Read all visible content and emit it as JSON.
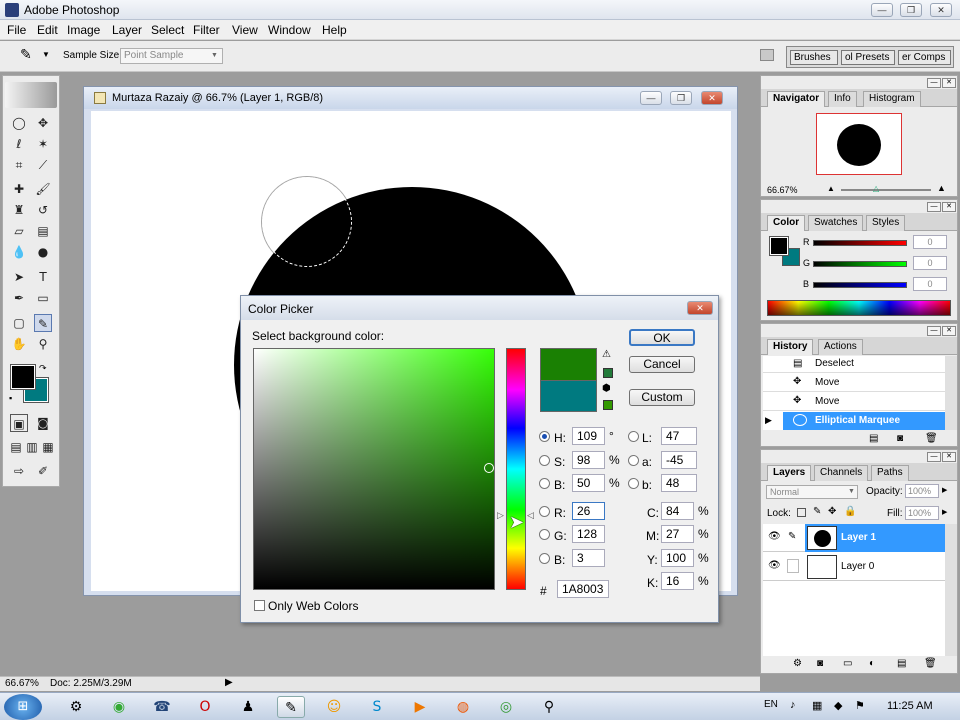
{
  "app": {
    "title": "Adobe Photoshop"
  },
  "menu": [
    "File",
    "Edit",
    "Image",
    "Layer",
    "Select",
    "Filter",
    "View",
    "Window",
    "Help"
  ],
  "options": {
    "sample_label": "Sample Size:",
    "sample_value": "Point Sample",
    "tabs": [
      "Brushes",
      "ol Presets",
      "er Comps"
    ]
  },
  "document": {
    "title": "Murtaza Razaiy @ 66.7% (Layer 1, RGB/8)"
  },
  "picker": {
    "title": "Color Picker",
    "prompt": "Select background color:",
    "ok": "OK",
    "cancel": "Cancel",
    "custom": "Custom",
    "new_color": "#1a8003",
    "current_color": "#007a80",
    "hsb": [
      {
        "label": "H:",
        "value": "109",
        "unit": "°"
      },
      {
        "label": "S:",
        "value": "98",
        "unit": "%"
      },
      {
        "label": "B:",
        "value": "50",
        "unit": "%"
      }
    ],
    "rgb": [
      {
        "label": "R:",
        "value": "26"
      },
      {
        "label": "G:",
        "value": "128"
      },
      {
        "label": "B:",
        "value": "3"
      }
    ],
    "lab": [
      {
        "label": "L:",
        "value": "47"
      },
      {
        "label": "a:",
        "value": "-45"
      },
      {
        "label": "b:",
        "value": "48"
      }
    ],
    "cmyk": [
      {
        "label": "C:",
        "value": "84",
        "unit": "%"
      },
      {
        "label": "M:",
        "value": "27",
        "unit": "%"
      },
      {
        "label": "Y:",
        "value": "100",
        "unit": "%"
      },
      {
        "label": "K:",
        "value": "16",
        "unit": "%"
      }
    ],
    "hex_label": "#",
    "hex": "1A8003",
    "web_only": "Only Web Colors"
  },
  "navigator": {
    "tabs": [
      "Navigator",
      "Info",
      "Histogram"
    ],
    "zoom": "66.67%"
  },
  "color_panel": {
    "tabs": [
      "Color",
      "Swatches",
      "Styles"
    ],
    "channels": [
      {
        "label": "R",
        "value": "0"
      },
      {
        "label": "G",
        "value": "0"
      },
      {
        "label": "B",
        "value": "0"
      }
    ]
  },
  "history": {
    "tabs": [
      "History",
      "Actions"
    ],
    "items": [
      "Deselect",
      "Move",
      "Move",
      "Elliptical Marquee"
    ]
  },
  "layers": {
    "tabs": [
      "Layers",
      "Channels",
      "Paths"
    ],
    "blend": "Normal",
    "opacity_label": "Opacity:",
    "opacity": "100%",
    "lock_label": "Lock:",
    "fill_label": "Fill:",
    "fill": "100%",
    "items": [
      "Layer 1",
      "Layer 0"
    ]
  },
  "status": {
    "zoom": "66.67%",
    "doc": "Doc: 2.25M/3.29M"
  },
  "taskbar": {
    "lang": "EN",
    "time": "11:25 AM"
  }
}
